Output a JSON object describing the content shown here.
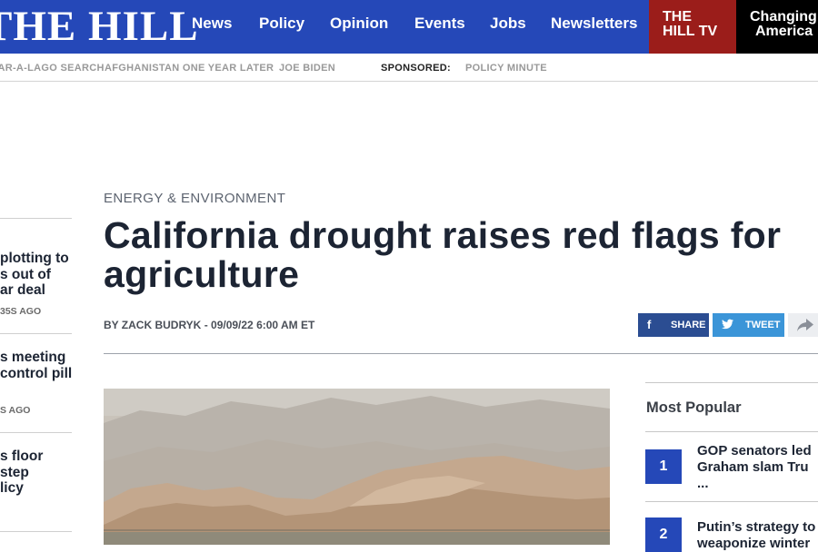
{
  "brand": {
    "logo_text": "THE HILL",
    "accent": "#2548b8"
  },
  "nav": [
    "News",
    "Policy",
    "Opinion",
    "Events",
    "Jobs",
    "Newsletters"
  ],
  "hill_tv": {
    "line1": "THE",
    "line2": "HILL TV"
  },
  "changing": {
    "line1": "Changing",
    "line2": "America"
  },
  "subnav": {
    "items": [
      "MAR-A-LAGO SEARCH",
      "AFGHANISTAN ONE YEAR LATER",
      "JOE BIDEN"
    ],
    "sponsored_label": "SPONSORED:",
    "sponsored_item": "POLICY MINUTE"
  },
  "sidebar": [
    {
      "lines": [
        "plotting to",
        "s out of",
        "ar deal"
      ],
      "time": "35S AGO"
    },
    {
      "lines": [
        "s meeting",
        "control pill",
        ""
      ],
      "time": "S AGO"
    },
    {
      "lines": [
        "s floor",
        "step",
        "licy"
      ],
      "time": ""
    }
  ],
  "article": {
    "category": "ENERGY & ENVIRONMENT",
    "headline": "California drought raises red flags for agriculture",
    "byline_prefix": "BY ",
    "author": "ZACK BUDRYK",
    "date": " - 09/09/22 6:00 AM ET"
  },
  "share": {
    "facebook": {
      "label": "SHARE",
      "icon": "f"
    },
    "twitter": {
      "label": "TWEET",
      "icon": "twitter-bird"
    },
    "more_icon": "share-arrow-icon"
  },
  "most_popular": {
    "title": "Most Popular",
    "items": [
      {
        "rank": "1",
        "lines": [
          "GOP senators led",
          "Graham slam Tru",
          "..."
        ]
      },
      {
        "rank": "2",
        "lines": [
          "Putin’s strategy to",
          "weaponize winter"
        ]
      }
    ]
  },
  "colors": {
    "hill_tv_bg": "#9b1d1a",
    "facebook": "#2b4d92",
    "twitter": "#3b95d8"
  }
}
